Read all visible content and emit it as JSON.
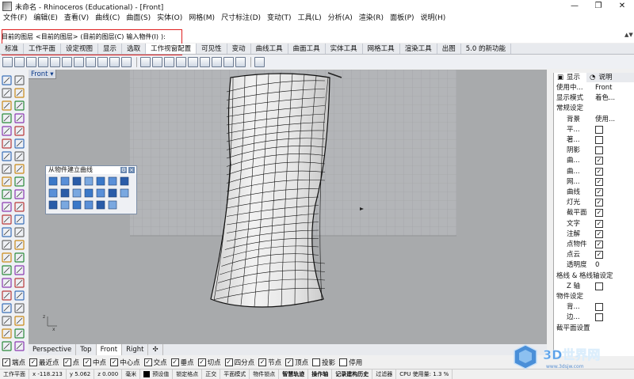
{
  "window": {
    "title": "未命名 - Rhinoceros (Educational) - [Front]",
    "controls": [
      "—",
      "❐",
      "✕"
    ]
  },
  "menu": [
    "文件(F)",
    "编辑(E)",
    "查看(V)",
    "曲线(C)",
    "曲面(S)",
    "实体(O)",
    "网格(M)",
    "尺寸标注(D)",
    "变动(T)",
    "工具(L)",
    "分析(A)",
    "渲染(R)",
    "面板(P)",
    "说明(H)"
  ],
  "command": {
    "prompt": "目前的图层",
    "options": [
      "<目前的图层>",
      "(目前的图层(C)",
      "输入物件(I)",
      "):"
    ]
  },
  "toolbar_tabs": [
    "标准",
    "工作平面",
    "设定视图",
    "显示",
    "选取",
    "工作视窗配置",
    "可见性",
    "变动",
    "曲线工具",
    "曲面工具",
    "实体工具",
    "网格工具",
    "渲染工具",
    "出图",
    "5.0 的新功能"
  ],
  "viewport": {
    "label": "Front",
    "dropdown": "▾"
  },
  "float_panel": {
    "title": "从物件建立曲线",
    "gear": "⚙",
    "close": "×"
  },
  "viewport_tabs": [
    "Perspective",
    "Top",
    "Front",
    "Right",
    "✣"
  ],
  "right_panel": {
    "tabs": [
      "显示",
      "说明"
    ],
    "rows": [
      {
        "label": "使用中...",
        "value": "Front"
      },
      {
        "label": "显示模式",
        "value": "着色..."
      },
      {
        "label": "常规设定",
        "value": ""
      },
      {
        "label": "背景",
        "value": "使用..."
      },
      {
        "label": "平...",
        "check": false
      },
      {
        "label": "著...",
        "check": false
      },
      {
        "label": "阴影",
        "check": false
      },
      {
        "label": "曲...",
        "check": true
      },
      {
        "label": "曲...",
        "check": true
      },
      {
        "label": "网...",
        "check": true
      },
      {
        "label": "曲线",
        "check": true
      },
      {
        "label": "灯光",
        "check": true
      },
      {
        "label": "截平面",
        "check": true
      },
      {
        "label": "文字",
        "check": true
      },
      {
        "label": "注解",
        "check": true
      },
      {
        "label": "点物件",
        "check": true
      },
      {
        "label": "点云",
        "check": true
      },
      {
        "label": "透明度",
        "value": "0"
      },
      {
        "label": "格线 & 格线轴设定",
        "value": ""
      },
      {
        "label": "Z 轴",
        "check": false
      },
      {
        "label": "物件设定",
        "value": ""
      },
      {
        "label": "背...",
        "check": false
      },
      {
        "label": "边...",
        "check": false
      },
      {
        "label": "截平面设置",
        "value": ""
      }
    ]
  },
  "osnaps": [
    {
      "label": "端点",
      "on": true
    },
    {
      "label": "最近点",
      "on": true
    },
    {
      "label": "点",
      "on": true
    },
    {
      "label": "中点",
      "on": true
    },
    {
      "label": "中心点",
      "on": true
    },
    {
      "label": "交点",
      "on": true
    },
    {
      "label": "垂点",
      "on": true
    },
    {
      "label": "切点",
      "on": true
    },
    {
      "label": "四分点",
      "on": true
    },
    {
      "label": "节点",
      "on": true
    },
    {
      "label": "顶点",
      "on": true
    },
    {
      "label": "投影",
      "on": false
    },
    {
      "label": "停用",
      "on": false
    }
  ],
  "status": {
    "plane": "工作平面",
    "x": "x -118.213",
    "y": "y 5.062",
    "z": "z 0.000",
    "units": "毫米",
    "layer": "预设值",
    "items": [
      "锁定格点",
      "正交",
      "平面模式",
      "物件锁点",
      "智慧轨迹",
      "操作轴",
      "记录建构历史",
      "过滤器",
      "CPU 使用量: 1.3 %"
    ]
  },
  "watermark": {
    "text": "3D世界网",
    "url": "www.3dsjw.com"
  },
  "colors": {
    "accent_red": "#e02020",
    "viewport_bg": "#a8aaac",
    "grid_panel": "#b3b5b8"
  }
}
